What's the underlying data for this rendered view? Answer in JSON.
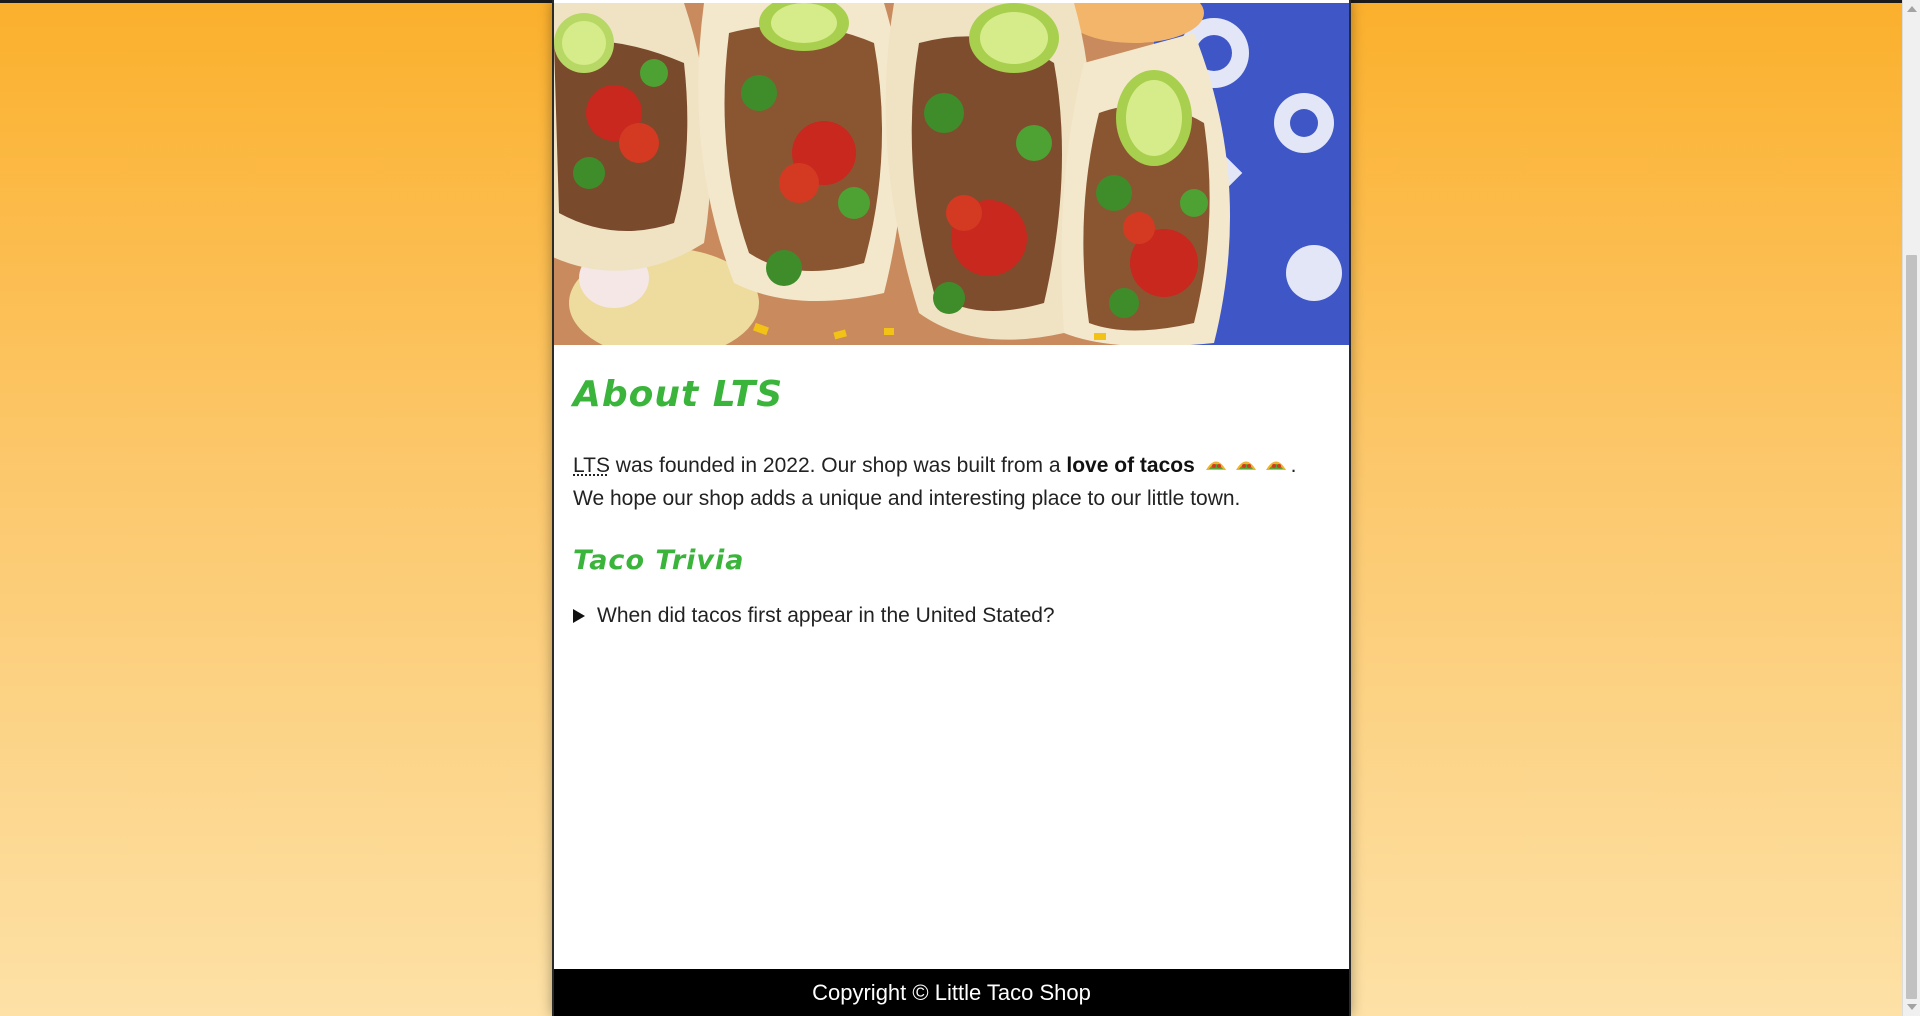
{
  "about": {
    "heading": "About LTS",
    "abbr": "LTS",
    "text_before_bold": " was founded in 2022. Our shop was built from a ",
    "bold": "love of tacos",
    "text_after": ". We hope our shop adds a unique and interesting place to our little town."
  },
  "trivia": {
    "heading": "Taco Trivia",
    "question": "When did tacos first appear in the United Stated?"
  },
  "footer": {
    "text": "Copyright © Little Taco Shop"
  },
  "icons": {
    "hero": "tacos-photo",
    "taco_emoji": "taco-emoji",
    "disclosure": "triangle-right-icon"
  },
  "colors": {
    "accent": "#3bb43b",
    "background_top": "#fbb02c",
    "background_bottom": "#fde1a6",
    "footer": "#000000"
  }
}
